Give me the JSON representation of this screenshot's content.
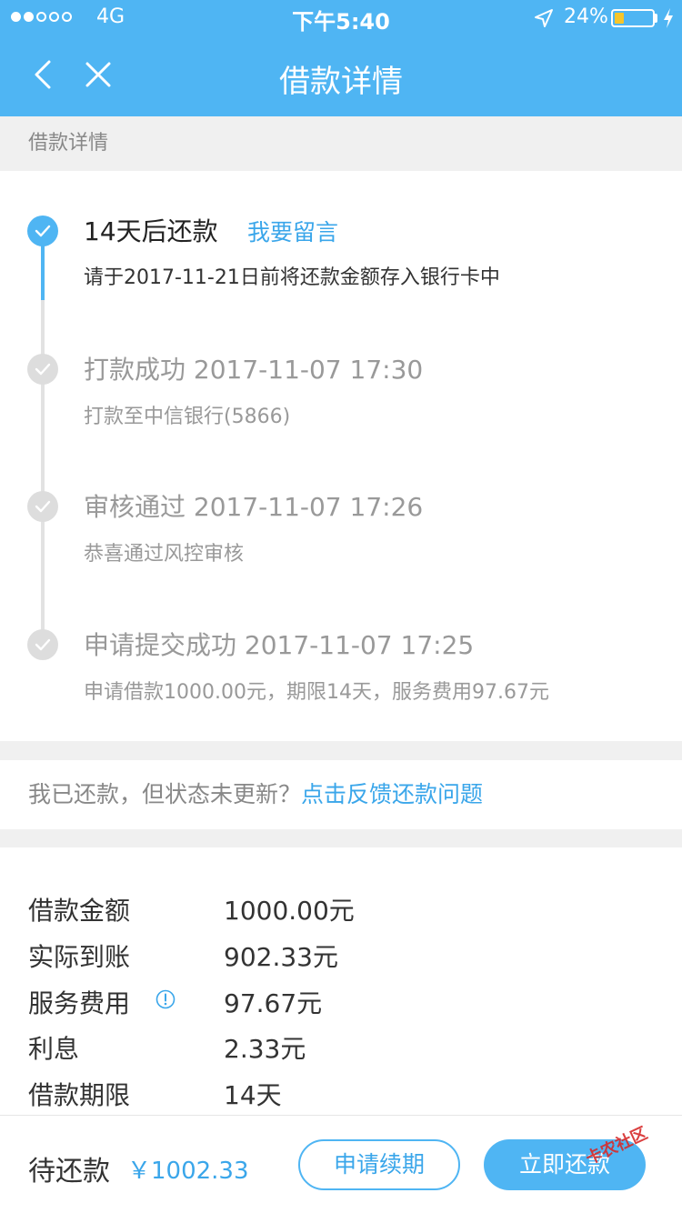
{
  "status_bar": {
    "carrier": "4G",
    "time": "下午5:40",
    "battery": "24%",
    "battery_level": 0.24
  },
  "nav": {
    "title": "借款详情",
    "back_icon": "chevron-left-icon",
    "close_icon": "close-icon"
  },
  "section_label": "借款详情",
  "timeline": {
    "steps": [
      {
        "title": "14天后还款",
        "desc": "请于2017-11-21日前将还款金额存入银行卡中",
        "link": "我要留言",
        "active": true
      },
      {
        "title": "打款成功 2017-11-07 17:30",
        "desc": "打款至中信银行(5866)",
        "active": false
      },
      {
        "title": "审核通过 2017-11-07 17:26",
        "desc": "恭喜通过风控审核",
        "active": false
      },
      {
        "title": "申请提交成功 2017-11-07 17:25",
        "desc": "申请借款1000.00元，期限14天，服务费用97.67元",
        "active": false
      }
    ]
  },
  "feedback": {
    "prefix": "我已还款，但状态未更新？",
    "link": "点击反馈还款问题"
  },
  "details": [
    {
      "label": "借款金额",
      "value": "1000.00元"
    },
    {
      "label": "实际到账",
      "value": "902.33元"
    },
    {
      "label": "服务费用",
      "value": "97.67元",
      "has_info_icon": true
    },
    {
      "label": "利息",
      "value": "2.33元"
    },
    {
      "label": "借款期限",
      "value": "14天"
    }
  ],
  "bottom_bar": {
    "pending_label": "待还款",
    "pending_amount": "￥1002.33",
    "extend_button": "申请续期",
    "repay_button": "立即还款"
  },
  "watermark": "卡农社区",
  "colors": {
    "brand": "#4fb5f3",
    "link": "#3aa6ea",
    "battery": "#f7c52a"
  }
}
